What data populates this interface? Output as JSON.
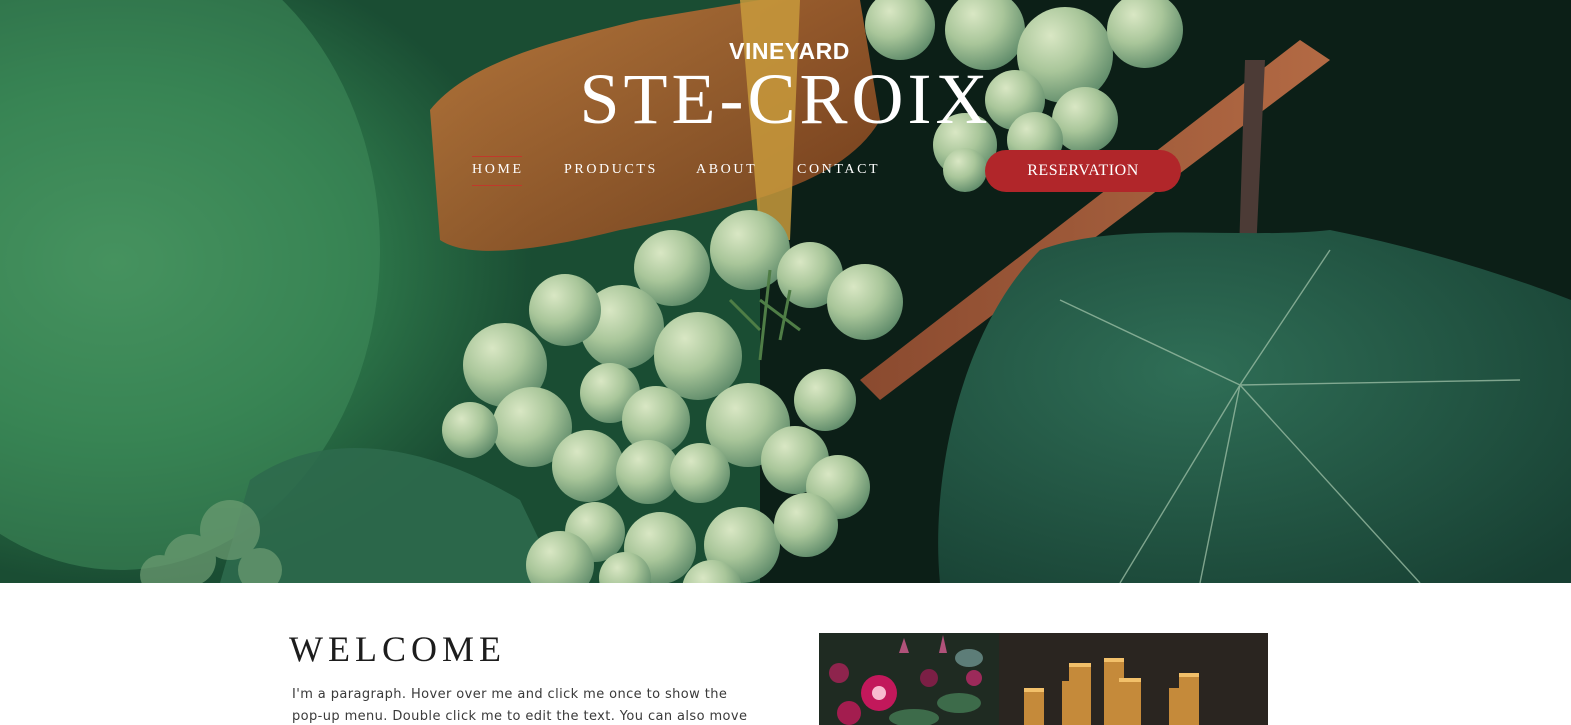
{
  "brand": {
    "subtitle": "VINEYARD",
    "title": "STE-CROIX"
  },
  "nav": {
    "items": [
      {
        "label": "HOME",
        "active": true
      },
      {
        "label": "PRODUCTS",
        "active": false
      },
      {
        "label": "ABOUT",
        "active": false
      },
      {
        "label": "CONTACT",
        "active": false
      }
    ],
    "cta_label": "RESERVATION"
  },
  "welcome": {
    "title": "WELCOME",
    "paragraph_line1": "I'm a paragraph. Hover over me and click me once to show the",
    "paragraph_line2": "pop-up menu. Double click me to edit the text. You can also move"
  },
  "colors": {
    "accent": "#b1262a",
    "text_dark": "#1d1d1d",
    "text_body": "#3a3a3a"
  }
}
